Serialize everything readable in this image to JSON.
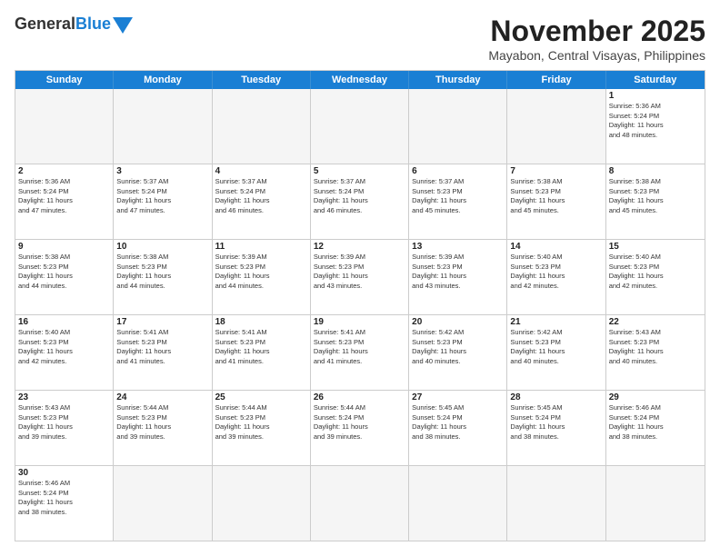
{
  "header": {
    "logo_general": "General",
    "logo_blue": "Blue",
    "month_title": "November 2025",
    "location": "Mayabon, Central Visayas, Philippines"
  },
  "days_of_week": [
    "Sunday",
    "Monday",
    "Tuesday",
    "Wednesday",
    "Thursday",
    "Friday",
    "Saturday"
  ],
  "weeks": [
    [
      {
        "day": "",
        "info": ""
      },
      {
        "day": "",
        "info": ""
      },
      {
        "day": "",
        "info": ""
      },
      {
        "day": "",
        "info": ""
      },
      {
        "day": "",
        "info": ""
      },
      {
        "day": "",
        "info": ""
      },
      {
        "day": "1",
        "info": "Sunrise: 5:36 AM\nSunset: 5:24 PM\nDaylight: 11 hours\nand 48 minutes."
      }
    ],
    [
      {
        "day": "2",
        "info": "Sunrise: 5:36 AM\nSunset: 5:24 PM\nDaylight: 11 hours\nand 47 minutes."
      },
      {
        "day": "3",
        "info": "Sunrise: 5:37 AM\nSunset: 5:24 PM\nDaylight: 11 hours\nand 47 minutes."
      },
      {
        "day": "4",
        "info": "Sunrise: 5:37 AM\nSunset: 5:24 PM\nDaylight: 11 hours\nand 46 minutes."
      },
      {
        "day": "5",
        "info": "Sunrise: 5:37 AM\nSunset: 5:24 PM\nDaylight: 11 hours\nand 46 minutes."
      },
      {
        "day": "6",
        "info": "Sunrise: 5:37 AM\nSunset: 5:23 PM\nDaylight: 11 hours\nand 45 minutes."
      },
      {
        "day": "7",
        "info": "Sunrise: 5:38 AM\nSunset: 5:23 PM\nDaylight: 11 hours\nand 45 minutes."
      },
      {
        "day": "8",
        "info": "Sunrise: 5:38 AM\nSunset: 5:23 PM\nDaylight: 11 hours\nand 45 minutes."
      }
    ],
    [
      {
        "day": "9",
        "info": "Sunrise: 5:38 AM\nSunset: 5:23 PM\nDaylight: 11 hours\nand 44 minutes."
      },
      {
        "day": "10",
        "info": "Sunrise: 5:38 AM\nSunset: 5:23 PM\nDaylight: 11 hours\nand 44 minutes."
      },
      {
        "day": "11",
        "info": "Sunrise: 5:39 AM\nSunset: 5:23 PM\nDaylight: 11 hours\nand 44 minutes."
      },
      {
        "day": "12",
        "info": "Sunrise: 5:39 AM\nSunset: 5:23 PM\nDaylight: 11 hours\nand 43 minutes."
      },
      {
        "day": "13",
        "info": "Sunrise: 5:39 AM\nSunset: 5:23 PM\nDaylight: 11 hours\nand 43 minutes."
      },
      {
        "day": "14",
        "info": "Sunrise: 5:40 AM\nSunset: 5:23 PM\nDaylight: 11 hours\nand 42 minutes."
      },
      {
        "day": "15",
        "info": "Sunrise: 5:40 AM\nSunset: 5:23 PM\nDaylight: 11 hours\nand 42 minutes."
      }
    ],
    [
      {
        "day": "16",
        "info": "Sunrise: 5:40 AM\nSunset: 5:23 PM\nDaylight: 11 hours\nand 42 minutes."
      },
      {
        "day": "17",
        "info": "Sunrise: 5:41 AM\nSunset: 5:23 PM\nDaylight: 11 hours\nand 41 minutes."
      },
      {
        "day": "18",
        "info": "Sunrise: 5:41 AM\nSunset: 5:23 PM\nDaylight: 11 hours\nand 41 minutes."
      },
      {
        "day": "19",
        "info": "Sunrise: 5:41 AM\nSunset: 5:23 PM\nDaylight: 11 hours\nand 41 minutes."
      },
      {
        "day": "20",
        "info": "Sunrise: 5:42 AM\nSunset: 5:23 PM\nDaylight: 11 hours\nand 40 minutes."
      },
      {
        "day": "21",
        "info": "Sunrise: 5:42 AM\nSunset: 5:23 PM\nDaylight: 11 hours\nand 40 minutes."
      },
      {
        "day": "22",
        "info": "Sunrise: 5:43 AM\nSunset: 5:23 PM\nDaylight: 11 hours\nand 40 minutes."
      }
    ],
    [
      {
        "day": "23",
        "info": "Sunrise: 5:43 AM\nSunset: 5:23 PM\nDaylight: 11 hours\nand 39 minutes."
      },
      {
        "day": "24",
        "info": "Sunrise: 5:44 AM\nSunset: 5:23 PM\nDaylight: 11 hours\nand 39 minutes."
      },
      {
        "day": "25",
        "info": "Sunrise: 5:44 AM\nSunset: 5:23 PM\nDaylight: 11 hours\nand 39 minutes."
      },
      {
        "day": "26",
        "info": "Sunrise: 5:44 AM\nSunset: 5:24 PM\nDaylight: 11 hours\nand 39 minutes."
      },
      {
        "day": "27",
        "info": "Sunrise: 5:45 AM\nSunset: 5:24 PM\nDaylight: 11 hours\nand 38 minutes."
      },
      {
        "day": "28",
        "info": "Sunrise: 5:45 AM\nSunset: 5:24 PM\nDaylight: 11 hours\nand 38 minutes."
      },
      {
        "day": "29",
        "info": "Sunrise: 5:46 AM\nSunset: 5:24 PM\nDaylight: 11 hours\nand 38 minutes."
      }
    ],
    [
      {
        "day": "30",
        "info": "Sunrise: 5:46 AM\nSunset: 5:24 PM\nDaylight: 11 hours\nand 38 minutes."
      },
      {
        "day": "",
        "info": ""
      },
      {
        "day": "",
        "info": ""
      },
      {
        "day": "",
        "info": ""
      },
      {
        "day": "",
        "info": ""
      },
      {
        "day": "",
        "info": ""
      },
      {
        "day": "",
        "info": ""
      }
    ]
  ]
}
